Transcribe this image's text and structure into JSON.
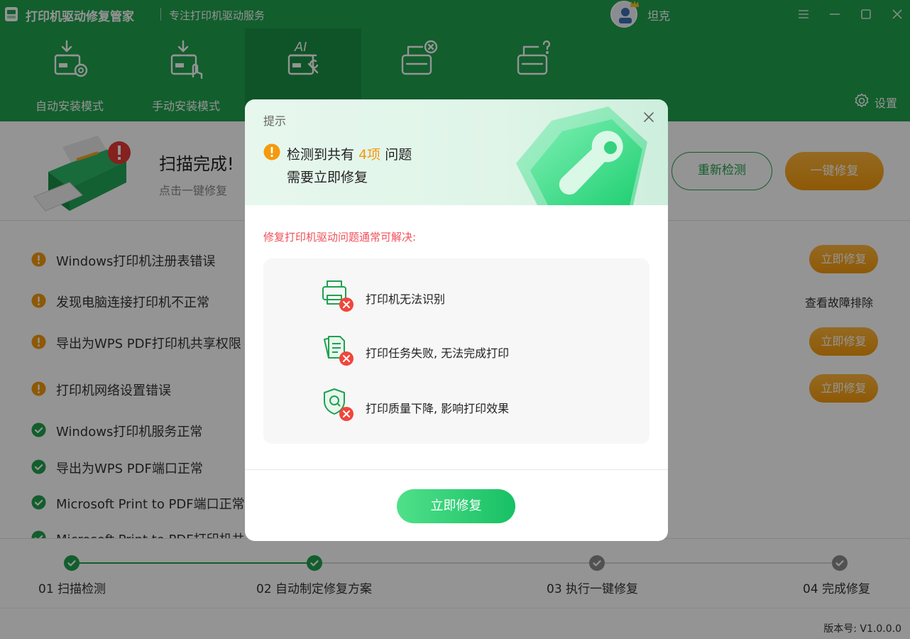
{
  "app": {
    "title": "打印机驱动修复管家",
    "subtitle": "专注打印机驱动服务",
    "username": "坦克"
  },
  "modes": [
    {
      "label": "自动安装模式",
      "icon": "printer-download-gear-icon",
      "active": false
    },
    {
      "label": "手动安装模式",
      "icon": "printer-download-hand-icon",
      "active": false
    },
    {
      "label": "",
      "icon": "ai-printer-wrench-icon",
      "active": true
    },
    {
      "label": "",
      "icon": "printer-error-icon",
      "active": false
    },
    {
      "label": "",
      "icon": "printer-question-icon",
      "active": false
    }
  ],
  "settings_label": "设置",
  "summary": {
    "title": "扫描完成!",
    "subtitle": "点击一键修复",
    "rescan_label": "重新检测",
    "fix_all_label": "一键修复"
  },
  "issues": [
    {
      "text": "Windows打印机注册表错误",
      "status": "warning",
      "action": "立即修复",
      "action_type": "button"
    },
    {
      "text": "发现电脑连接打印机不正常",
      "status": "warning",
      "action": "查看故障排除",
      "action_type": "link"
    },
    {
      "text": "导出为WPS PDF打印机共享权限",
      "status": "warning",
      "action": "立即修复",
      "action_type": "button"
    },
    {
      "text": "打印机网络设置错误",
      "status": "warning",
      "action": "立即修复",
      "action_type": "button"
    },
    {
      "text": "Windows打印机服务正常",
      "status": "ok",
      "action": "",
      "action_type": "none"
    },
    {
      "text": "导出为WPS PDF端口正常",
      "status": "ok",
      "action": "",
      "action_type": "none"
    },
    {
      "text": "Microsoft Print to PDF端口正常",
      "status": "ok",
      "action": "",
      "action_type": "none"
    },
    {
      "text": "Microsoft Print to PDF打印机共",
      "status": "ok",
      "action": "",
      "action_type": "none"
    }
  ],
  "steps": [
    {
      "label": "01 扫描检测",
      "done": true
    },
    {
      "label": "02 自动制定修复方案",
      "done": true
    },
    {
      "label": "03 执行一键修复",
      "done": false
    },
    {
      "label": "04 完成修复",
      "done": false
    }
  ],
  "version": "版本号: V1.0.0.0",
  "dialog": {
    "title": "提示",
    "line1_prefix": "检测到共有",
    "line1_count": "4项",
    "line1_suffix": "问题",
    "line2": "需要立即修复",
    "hint": "修复打印机驱动问题通常可解决:",
    "benefits": [
      {
        "text": "打印机无法识别",
        "icon": "printer-x-icon"
      },
      {
        "text": "打印任务失败, 无法完成打印",
        "icon": "documents-x-icon"
      },
      {
        "text": "打印质量下降, 影响打印效果",
        "icon": "shield-search-x-icon"
      }
    ],
    "fix_label": "立即修复"
  },
  "colors": {
    "brand_green": "#1fa24e",
    "accent_orange": "#f59a0c",
    "warning_red": "#f0505a"
  }
}
